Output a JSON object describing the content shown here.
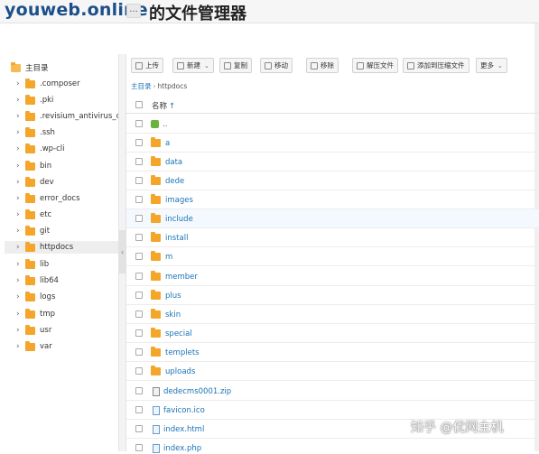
{
  "header": {
    "site_name": "youweb.online",
    "more": "...",
    "title": "的文件管理器"
  },
  "sidebar": {
    "root_label": "主目录",
    "items": [
      {
        "label": ".composer"
      },
      {
        "label": ".pki"
      },
      {
        "label": ".revisium_antivirus_cache"
      },
      {
        "label": ".ssh"
      },
      {
        "label": ".wp-cli"
      },
      {
        "label": "bin"
      },
      {
        "label": "dev"
      },
      {
        "label": "error_docs"
      },
      {
        "label": "etc"
      },
      {
        "label": "git"
      },
      {
        "label": "httpdocs",
        "active": true
      },
      {
        "label": "lib"
      },
      {
        "label": "lib64"
      },
      {
        "label": "logs"
      },
      {
        "label": "tmp"
      },
      {
        "label": "usr"
      },
      {
        "label": "var"
      }
    ]
  },
  "toolbar": {
    "upload": "上传",
    "new": "新建",
    "copy": "复制",
    "move": "移动",
    "remove": "移除",
    "extract": "解压文件",
    "add_archive": "添加到压缩文件",
    "more": "更多"
  },
  "breadcrumb": {
    "root": "主目录",
    "separator": "›",
    "current": "httpdocs"
  },
  "list": {
    "header_name": "名称",
    "sort_indicator": "↑",
    "rows": [
      {
        "name": "..",
        "kind": "up"
      },
      {
        "name": "a",
        "kind": "folder"
      },
      {
        "name": "data",
        "kind": "folder"
      },
      {
        "name": "dede",
        "kind": "folder"
      },
      {
        "name": "images",
        "kind": "folder"
      },
      {
        "name": "include",
        "kind": "folder"
      },
      {
        "name": "install",
        "kind": "folder"
      },
      {
        "name": "m",
        "kind": "folder"
      },
      {
        "name": "member",
        "kind": "folder"
      },
      {
        "name": "plus",
        "kind": "folder"
      },
      {
        "name": "skin",
        "kind": "folder"
      },
      {
        "name": "special",
        "kind": "folder"
      },
      {
        "name": "templets",
        "kind": "folder"
      },
      {
        "name": "uploads",
        "kind": "folder"
      },
      {
        "name": "dedecms0001.zip",
        "kind": "zip"
      },
      {
        "name": "favicon.ico",
        "kind": "file"
      },
      {
        "name": "index.html",
        "kind": "file"
      },
      {
        "name": "index.php",
        "kind": "file"
      }
    ]
  },
  "watermark": "知乎 @优网主机"
}
